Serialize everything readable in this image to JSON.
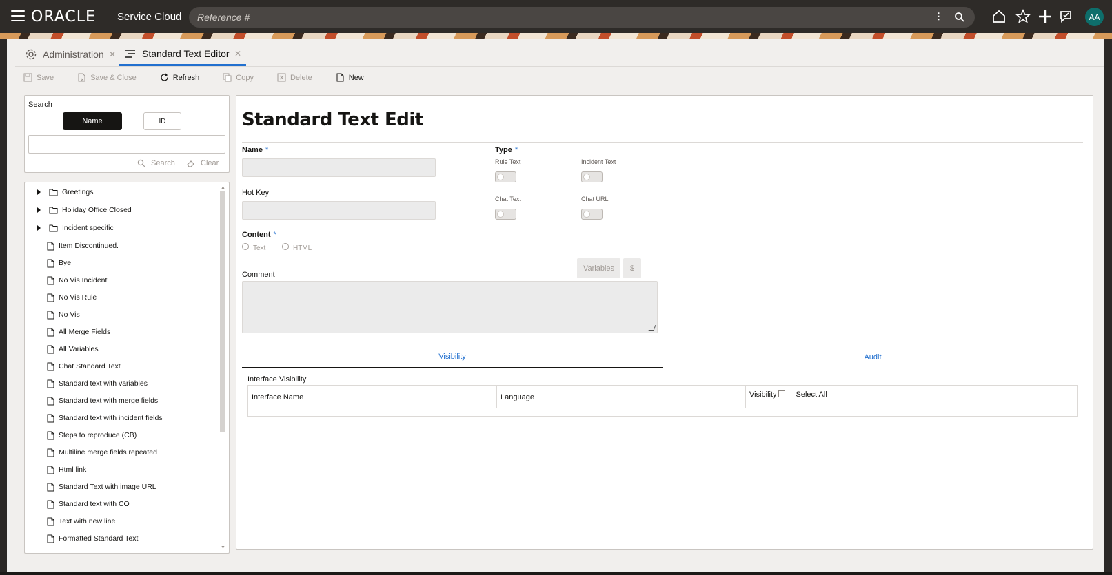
{
  "header": {
    "brand": "ORACLE",
    "product": "Service Cloud",
    "reference_placeholder": "Reference #",
    "avatar_initials": "AA",
    "avatar_color": "#0e6e6b"
  },
  "tabs": [
    {
      "label": "Administration",
      "active": false
    },
    {
      "label": "Standard Text Editor",
      "active": true
    }
  ],
  "toolbar": {
    "save": "Save",
    "save_close": "Save & Close",
    "refresh": "Refresh",
    "copy": "Copy",
    "delete": "Delete",
    "new": "New"
  },
  "search": {
    "label": "Search",
    "mode_name": "Name",
    "mode_id": "ID",
    "search_btn": "Search",
    "clear_btn": "Clear"
  },
  "tree": {
    "folders": [
      "Greetings",
      "Holiday Office Closed",
      "Incident specific"
    ],
    "items": [
      "Item Discontinued.",
      "Bye",
      "No Vis Incident",
      "No Vis Rule",
      "No Vis",
      "All Merge Fields",
      "All Variables",
      "Chat Standard Text",
      "Standard text with variables",
      "Standard text with merge fields",
      "Standard text with incident fields",
      "Steps to reproduce (CB)",
      "Multiline merge fields repeated",
      "Html link",
      "Standard Text with image URL",
      "Standard text with CO",
      "Text with new line",
      "Formatted Standard Text"
    ]
  },
  "editor": {
    "title": "Standard Text Edit",
    "name_label": "Name",
    "required_mark": "*",
    "hotkey_label": "Hot Key",
    "type_label": "Type",
    "switches": {
      "rule_text": "Rule Text",
      "incident_text": "Incident Text",
      "chat_text": "Chat Text",
      "chat_url": "Chat URL"
    },
    "content_label": "Content",
    "content_text": "Text",
    "content_html": "HTML",
    "comment_label": "Comment",
    "variables_btn": "Variables",
    "dollar_btn": "$",
    "subtabs": {
      "visibility": "Visibility",
      "audit": "Audit"
    },
    "interface_visibility": "Interface Visibility",
    "columns": {
      "interface_name": "Interface Name",
      "language": "Language",
      "visibility": "Visibility",
      "select_all": "Select All"
    }
  },
  "colors": {
    "accent": "#2270cf",
    "topbar": "#2e2b28"
  }
}
